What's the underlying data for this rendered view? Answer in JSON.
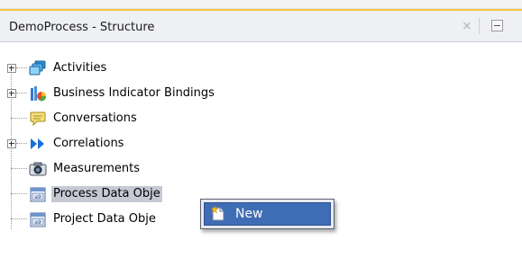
{
  "panel": {
    "title": "DemoProcess - Structure",
    "close_glyph": "×"
  },
  "tree": {
    "items": [
      {
        "label": "Activities",
        "icon": "activities-icon",
        "expandable": true
      },
      {
        "label": "Business Indicator Bindings",
        "icon": "business-indicator-icon",
        "expandable": true
      },
      {
        "label": "Conversations",
        "icon": "conversation-icon",
        "expandable": false
      },
      {
        "label": "Correlations",
        "icon": "correlation-icon",
        "expandable": true
      },
      {
        "label": "Measurements",
        "icon": "measurement-icon",
        "expandable": false
      },
      {
        "label": "Process Data Obje",
        "icon": "data-object-icon",
        "expandable": false,
        "selected": true
      },
      {
        "label": "Project Data Obje",
        "icon": "data-object-icon",
        "expandable": false
      }
    ]
  },
  "context_menu": {
    "items": [
      {
        "label": "New",
        "icon": "new-icon"
      }
    ]
  },
  "colors": {
    "accent_border": "#f4c23c",
    "selection": "#c5c9d4",
    "menu_highlight": "#3f6db5"
  }
}
